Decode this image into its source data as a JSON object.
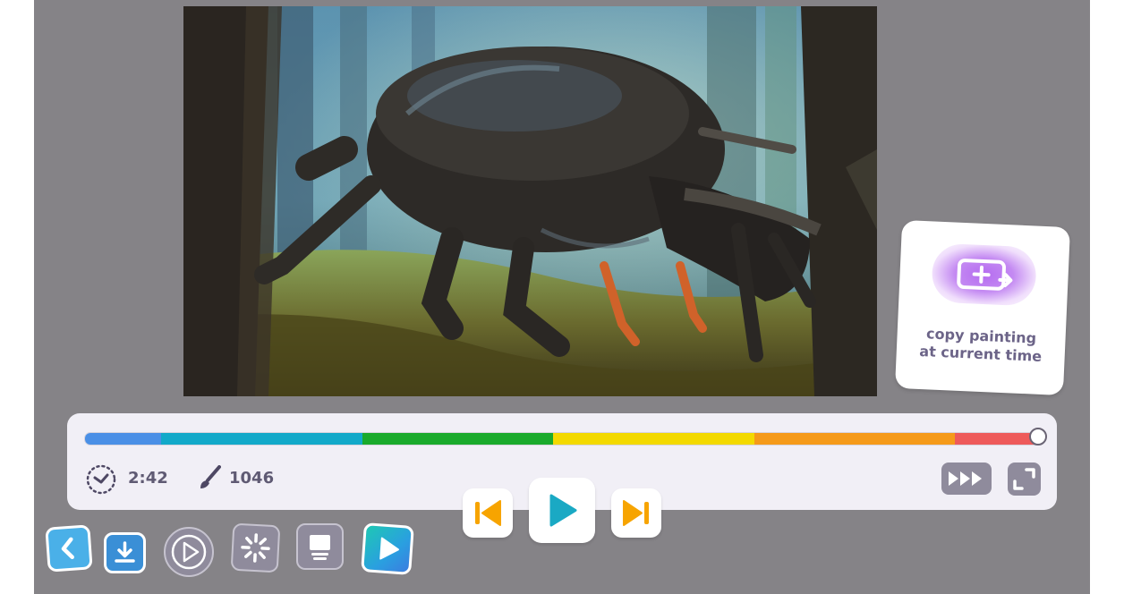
{
  "player": {
    "elapsed_time": "2:42",
    "stroke_count": "1046",
    "progress": 1.0
  },
  "copy_card": {
    "label": "copy painting\nat current time"
  },
  "colors": {
    "stage_bg": "#858387",
    "timeline_segments": [
      "#4a8fe6",
      "#12a9c9",
      "#1aaa2c",
      "#f3d900",
      "#f59a1a",
      "#ee5a5a"
    ],
    "transport_accent": "#f7a400",
    "play_accent": "#1aa9c4",
    "copy_icon_accent": "#a35be8",
    "text_muted": "#5f5a73"
  },
  "icons": {
    "clock": "clock-icon",
    "brush": "brush-icon",
    "skip_start": "skip-to-start-icon",
    "play": "play-icon",
    "skip_end": "skip-to-end-icon",
    "speed": "fast-forward-icon",
    "fullscreen": "fullscreen-icon",
    "back": "chevron-left-icon",
    "download": "download-icon",
    "playback": "playback-mode-icon",
    "spinner": "loading-icon",
    "monitor": "monitor-icon",
    "slideshow": "slideshow-play-icon",
    "copy": "copy-to-canvas-icon"
  }
}
